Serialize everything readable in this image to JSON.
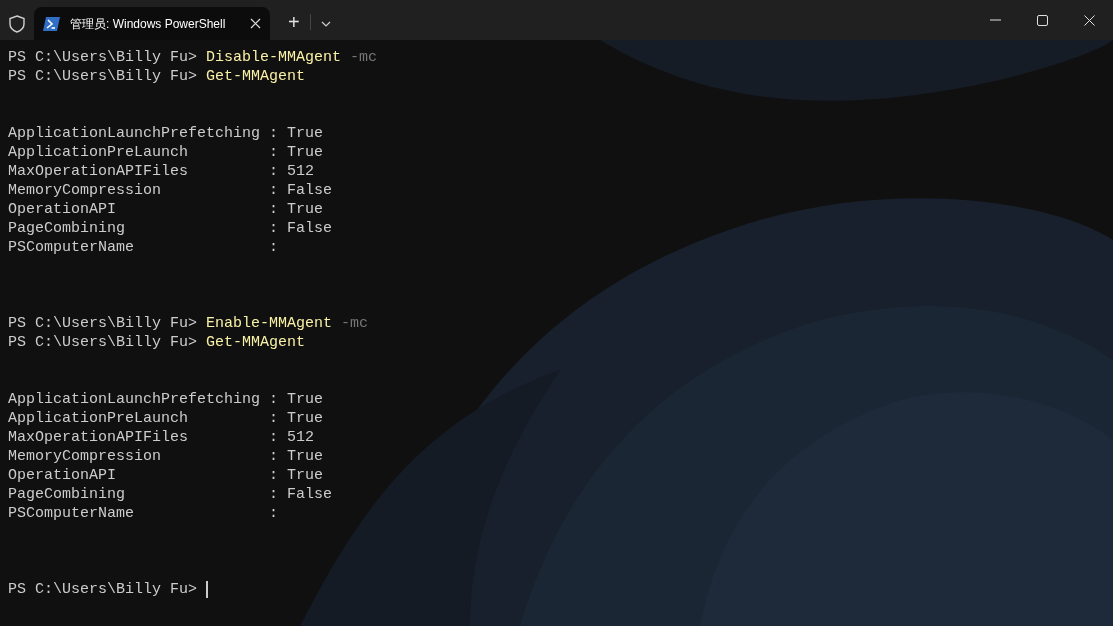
{
  "window": {
    "tab": {
      "title": "管理员: Windows PowerShell",
      "selected": true
    },
    "new_tab": "+"
  },
  "terminal": {
    "lines": [
      {
        "kind": "prompt",
        "prompt": "PS C:\\Users\\Billy Fu>",
        "command": "Disable-MMAgent",
        "parameter": "-mc"
      },
      {
        "kind": "prompt",
        "prompt": "PS C:\\Users\\Billy Fu>",
        "command": "Get-MMAgent"
      },
      {
        "kind": "blank"
      },
      {
        "kind": "blank"
      },
      {
        "kind": "output",
        "text": "ApplicationLaunchPrefetching : True"
      },
      {
        "kind": "output",
        "text": "ApplicationPreLaunch         : True"
      },
      {
        "kind": "output",
        "text": "MaxOperationAPIFiles         : 512"
      },
      {
        "kind": "output",
        "text": "MemoryCompression            : False"
      },
      {
        "kind": "output",
        "text": "OperationAPI                 : True"
      },
      {
        "kind": "output",
        "text": "PageCombining                : False"
      },
      {
        "kind": "output",
        "text": "PSComputerName               :"
      },
      {
        "kind": "blank"
      },
      {
        "kind": "blank"
      },
      {
        "kind": "blank"
      },
      {
        "kind": "prompt",
        "prompt": "PS C:\\Users\\Billy Fu>",
        "command": "Enable-MMAgent",
        "parameter": "-mc"
      },
      {
        "kind": "prompt",
        "prompt": "PS C:\\Users\\Billy Fu>",
        "command": "Get-MMAgent"
      },
      {
        "kind": "blank"
      },
      {
        "kind": "blank"
      },
      {
        "kind": "output",
        "text": "ApplicationLaunchPrefetching : True"
      },
      {
        "kind": "output",
        "text": "ApplicationPreLaunch         : True"
      },
      {
        "kind": "output",
        "text": "MaxOperationAPIFiles         : 512"
      },
      {
        "kind": "output",
        "text": "MemoryCompression            : True"
      },
      {
        "kind": "output",
        "text": "OperationAPI                 : True"
      },
      {
        "kind": "output",
        "text": "PageCombining                : False"
      },
      {
        "kind": "output",
        "text": "PSComputerName               :"
      },
      {
        "kind": "blank"
      },
      {
        "kind": "blank"
      },
      {
        "kind": "blank"
      },
      {
        "kind": "prompt",
        "prompt": "PS C:\\Users\\Billy Fu>",
        "cursor": true
      }
    ]
  }
}
